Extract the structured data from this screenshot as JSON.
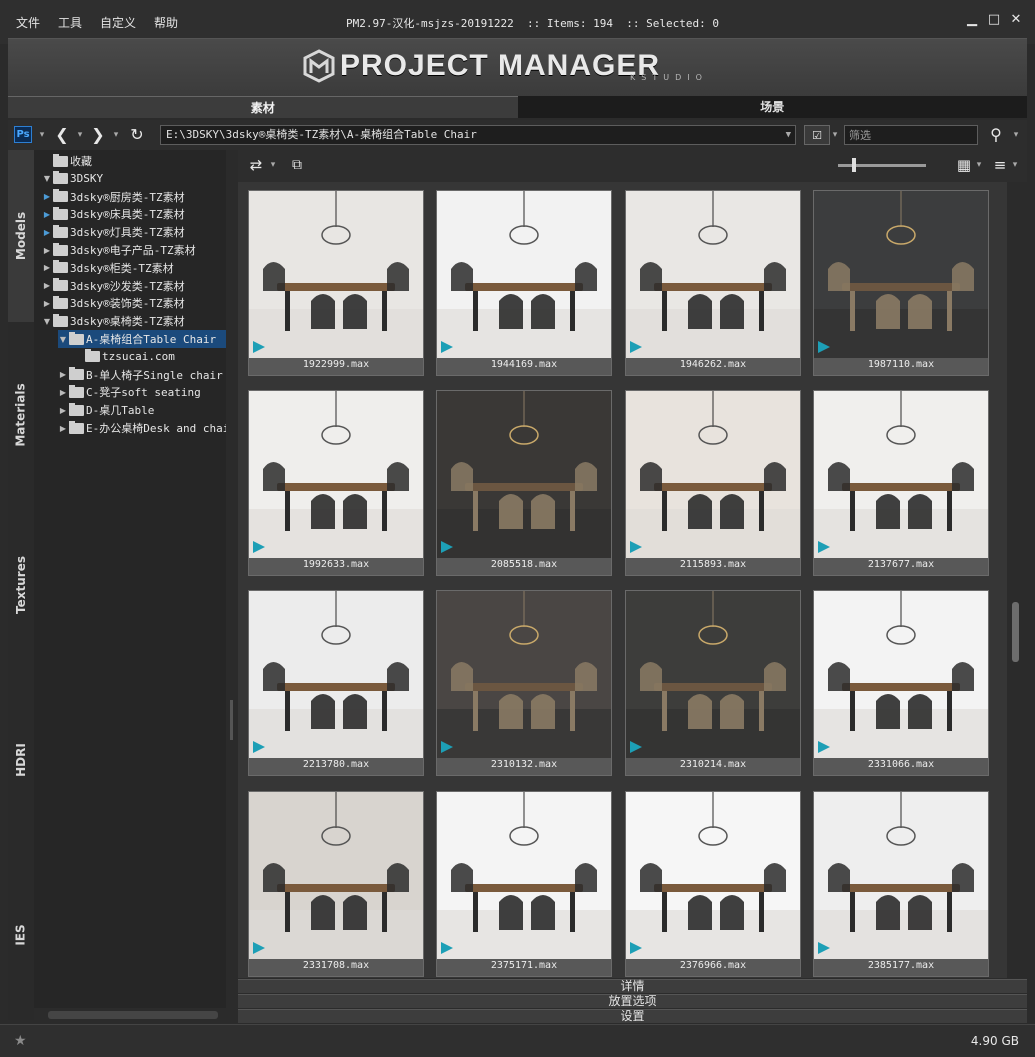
{
  "menu": [
    "文件",
    "工具",
    "自定义",
    "帮助"
  ],
  "title": {
    "version": "PM2.97-汉化-msjzs-20191222",
    "items_label": ":: Items: 194",
    "selected_label": ":: Selected: 0"
  },
  "banner": {
    "logo": "PROJECT MANAGER",
    "sub": "KSTUDIO"
  },
  "tabs": [
    "素材",
    "场景"
  ],
  "toolbar": {
    "app_icon": "Ps",
    "path": "E:\\3DSKY\\3dsky®桌椅类-TZ素材\\A-桌椅组合Table Chair",
    "filter_placeholder": "筛选"
  },
  "category_tabs": [
    "Models",
    "Materials",
    "Textures",
    "HDRI",
    "IES"
  ],
  "tree": [
    {
      "label": "收藏",
      "depth": 0,
      "arrow": "",
      "icon": "star-folder"
    },
    {
      "label": "3DSKY",
      "depth": 0,
      "arrow": "▼",
      "icon": "drive"
    },
    {
      "label": "3dsky®厨房类-TZ素材",
      "depth": 1,
      "arrow": "▶",
      "blue": true
    },
    {
      "label": "3dsky®床具类-TZ素材",
      "depth": 1,
      "arrow": "▶",
      "blue": true
    },
    {
      "label": "3dsky®灯具类-TZ素材",
      "depth": 1,
      "arrow": "▶",
      "blue": true
    },
    {
      "label": "3dsky®电子产品-TZ素材",
      "depth": 1,
      "arrow": "▶"
    },
    {
      "label": "3dsky®柜类-TZ素材",
      "depth": 1,
      "arrow": "▶"
    },
    {
      "label": "3dsky®沙发类-TZ素材",
      "depth": 1,
      "arrow": "▶"
    },
    {
      "label": "3dsky®装饰类-TZ素材",
      "depth": 1,
      "arrow": "▶"
    },
    {
      "label": "3dsky®桌椅类-TZ素材",
      "depth": 1,
      "arrow": "▼"
    },
    {
      "label": "A-桌椅组合Table Chair",
      "depth": 2,
      "arrow": "▼",
      "selected": true
    },
    {
      "label": "tzsucai.com",
      "depth": 3,
      "arrow": ""
    },
    {
      "label": "B-单人椅子Single chair",
      "depth": 2,
      "arrow": "▶"
    },
    {
      "label": "C-凳子soft seating",
      "depth": 2,
      "arrow": "▶"
    },
    {
      "label": "D-桌几Table",
      "depth": 2,
      "arrow": "▶"
    },
    {
      "label": "E-办公桌椅Desk and chair",
      "depth": 2,
      "arrow": "▶"
    }
  ],
  "items": [
    "1922999.max",
    "1944169.max",
    "1946262.max",
    "1987110.max",
    "1992633.max",
    "2085518.max",
    "2115893.max",
    "2137677.max",
    "2213780.max",
    "2310132.max",
    "2310214.max",
    "2331066.max",
    "2331708.max",
    "2375171.max",
    "2376966.max",
    "2385177.max"
  ],
  "thumb_tones": [
    "#e8e6e3",
    "#f2f2f2",
    "#e9e7e4",
    "#3c3d3e",
    "#efeeec",
    "#3a3836",
    "#e8e3dd",
    "#f0efed",
    "#ececec",
    "#4a4644",
    "#3d3d3b",
    "#f3f3f3",
    "#d8d4cf",
    "#f4f4f4",
    "#f6f6f6",
    "#eeeeee"
  ],
  "bottom_panels": [
    "详情",
    "放置选项",
    "设置"
  ],
  "status": {
    "free_space": "4.90 GB"
  }
}
